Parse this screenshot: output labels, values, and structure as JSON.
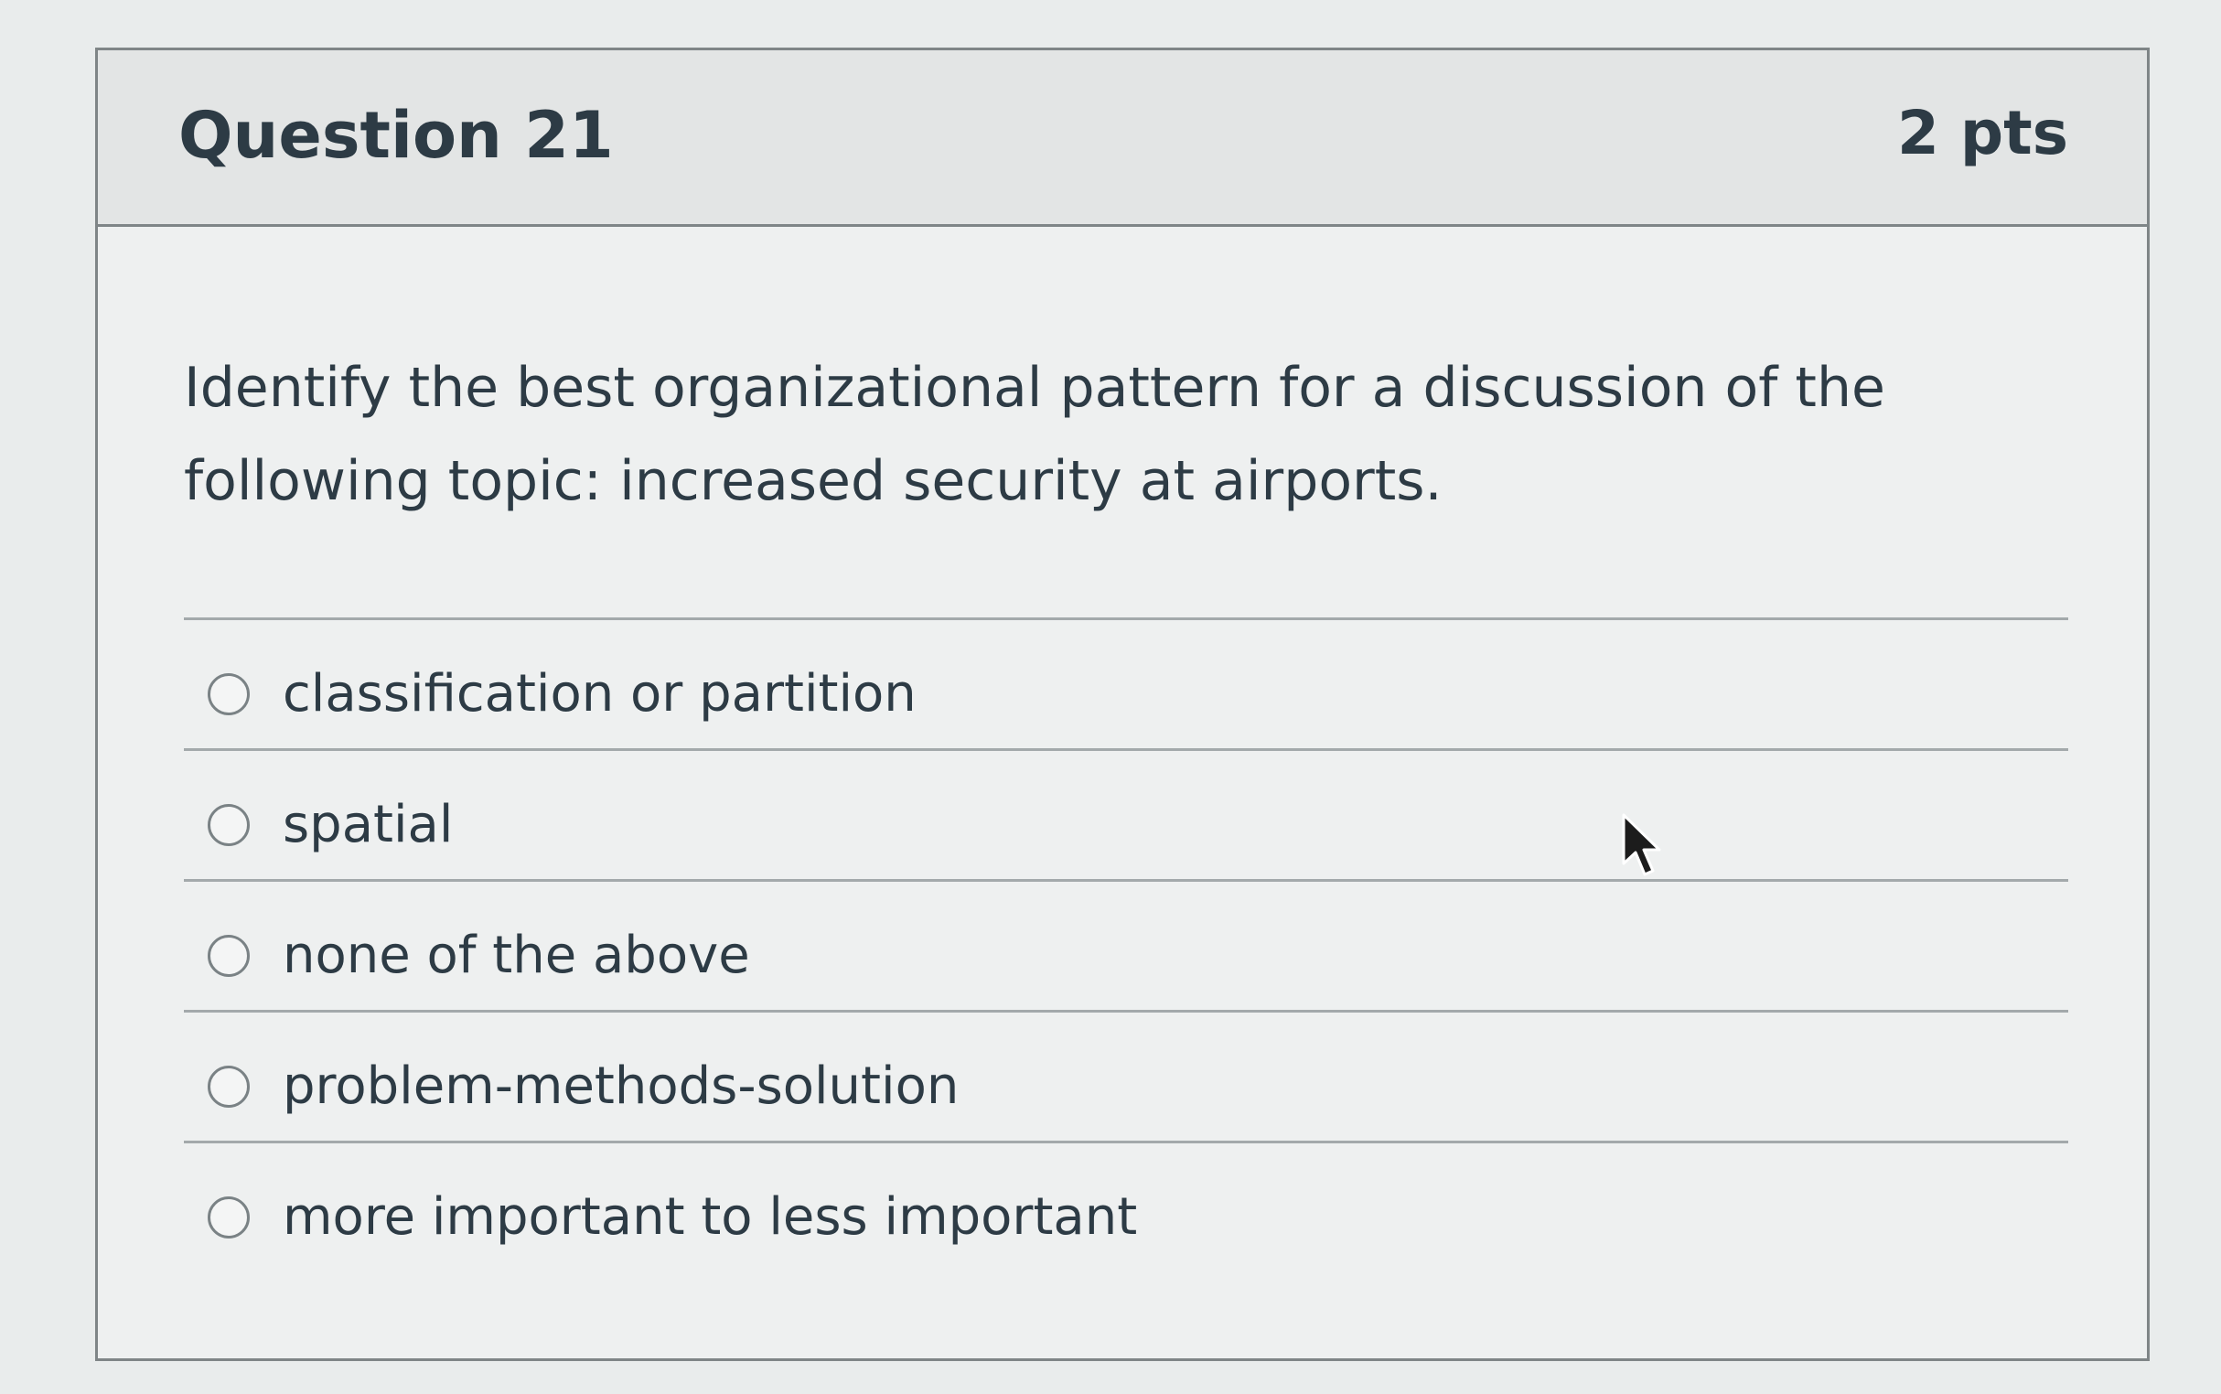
{
  "question": {
    "title": "Question 21",
    "points": "2 pts",
    "text": "Identify the best organizational pattern for a discussion of the following topic:  increased security at airports."
  },
  "answers": [
    {
      "label": "classification or partition",
      "selected": false
    },
    {
      "label": "spatial",
      "selected": false
    },
    {
      "label": "none of the above",
      "selected": false
    },
    {
      "label": "problem-methods-solution",
      "selected": false
    },
    {
      "label": "more important to less important",
      "selected": false
    }
  ],
  "colors": {
    "text": "#2d3b45",
    "border": "#7f8587",
    "header_bg": "#e3e5e5"
  },
  "icons": {
    "cursor": "mouse-pointer-icon",
    "radio": "radio-button"
  }
}
